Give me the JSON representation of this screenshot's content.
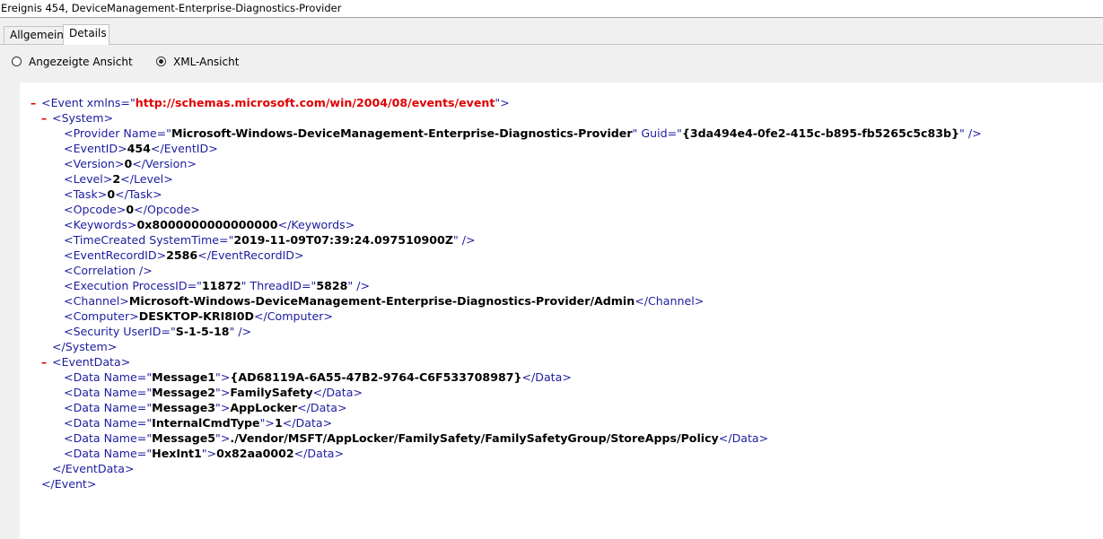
{
  "window": {
    "title": "Ereignis 454, DeviceManagement-Enterprise-Diagnostics-Provider"
  },
  "tabs": [
    {
      "label": "Allgemein",
      "active": false
    },
    {
      "label": "Details",
      "active": true
    }
  ],
  "view_options": [
    {
      "label": "Angezeigte Ansicht",
      "selected": false
    },
    {
      "label": "XML-Ansicht",
      "selected": true
    }
  ],
  "xml": {
    "event_tag": "Event",
    "xmlns_attr": "xmlns",
    "xmlns": "http://schemas.microsoft.com/win/2004/08/events/event",
    "system_tag": "System",
    "provider_tag": "Provider",
    "provider_name_attr": "Name",
    "provider_name": "Microsoft-Windows-DeviceManagement-Enterprise-Diagnostics-Provider",
    "provider_guid_attr": "Guid",
    "provider_guid": "{3da494e4-0fe2-415c-b895-fb5265c5c83b}",
    "simple_elements": [
      {
        "tag": "EventID",
        "value": "454"
      },
      {
        "tag": "Version",
        "value": "0"
      },
      {
        "tag": "Level",
        "value": "2"
      },
      {
        "tag": "Task",
        "value": "0"
      },
      {
        "tag": "Opcode",
        "value": "0"
      },
      {
        "tag": "Keywords",
        "value": "0x8000000000000000"
      }
    ],
    "time_created_tag": "TimeCreated",
    "system_time_attr": "SystemTime",
    "system_time": "2019-11-09T07:39:24.097510900Z",
    "event_record_tag": "EventRecordID",
    "event_record_id": "2586",
    "correlation_tag": "Correlation",
    "execution_tag": "Execution",
    "process_id_attr": "ProcessID",
    "process_id": "11872",
    "thread_id_attr": "ThreadID",
    "thread_id": "5828",
    "channel_tag": "Channel",
    "channel": "Microsoft-Windows-DeviceManagement-Enterprise-Diagnostics-Provider/Admin",
    "computer_tag": "Computer",
    "computer": "DESKTOP-KRI8I0D",
    "security_tag": "Security",
    "user_id_attr": "UserID",
    "user_id": "S-1-5-18",
    "event_data_tag": "EventData",
    "data_tag": "Data",
    "data_name_attr": "Name",
    "data_items": [
      {
        "name": "Message1",
        "value": "{AD68119A-6A55-47B2-9764-C6F533708987}"
      },
      {
        "name": "Message2",
        "value": "FamilySafety"
      },
      {
        "name": "Message3",
        "value": "AppLocker"
      },
      {
        "name": "InternalCmdType",
        "value": "1"
      },
      {
        "name": "Message5",
        "value": "./Vendor/MSFT/AppLocker/FamilySafety/FamilySafetyGroup/StoreApps/Policy"
      },
      {
        "name": "HexInt1",
        "value": "0x82aa0002"
      }
    ],
    "collapse_symbol": "–"
  }
}
